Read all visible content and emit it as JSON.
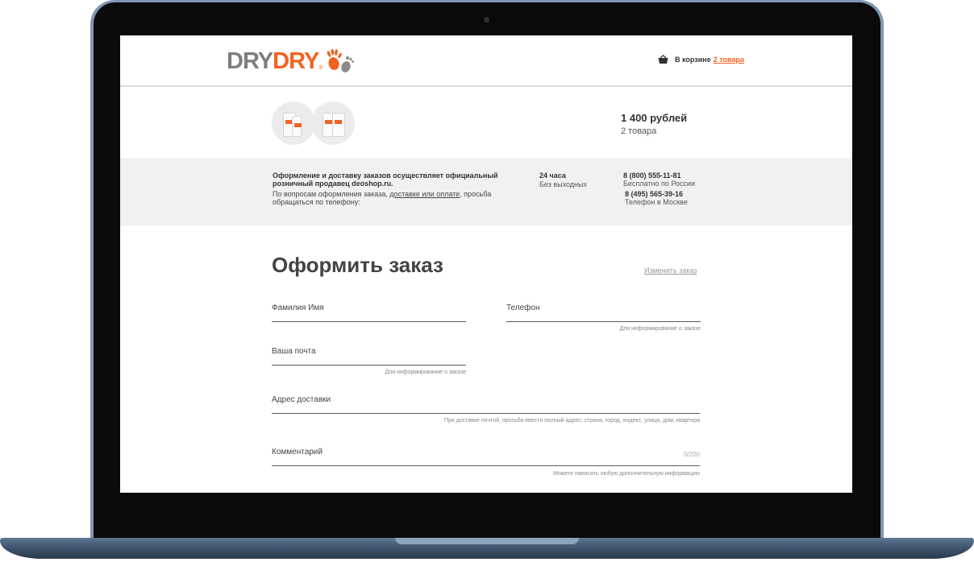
{
  "header": {
    "logo_left": "DRY",
    "logo_right": "DRY",
    "logo_reg": "®",
    "cart_label": "В корзине",
    "cart_link": "2 товара",
    "cart_icon": "basket-icon"
  },
  "order_summary": {
    "price": "1 400 рублей",
    "count": "2 товара"
  },
  "info": {
    "seller_bold": "Оформление и доставку заказов осуществляет официальный розничный продавец deoshop.ru.",
    "contact_before": "По вопросам оформления заказа, ",
    "contact_link": "доставке или оплате",
    "contact_after": ", просьба обращаться по телефону:",
    "hours": "24 часа",
    "days": "Без выходных",
    "phone1": "8 (800) 555-11-81",
    "phone1_note": "Бесплатно по России",
    "phone2": "8 (495) 565-39-16",
    "phone2_note": "Телефон в Москве"
  },
  "form": {
    "title": "Оформить заказ",
    "edit_link": "Изменить заказ",
    "name_label": "Фамилия Имя",
    "phone_label": "Телефон",
    "phone_hint": "Для информирование о заказе",
    "email_label": "Ваша почта",
    "email_hint": "Для информирование о заказе",
    "address_label": "Адрес доставки",
    "address_hint": "При доставке почтой, просьба ввести полный адрес: страна, город, индекс, улица, дом, квартира",
    "comment_label": "Комментарий",
    "comment_counter": "0/200",
    "comment_hint": "Можете написать любую дополнительную информацию"
  },
  "colors": {
    "brand_orange": "#f26322",
    "logo_gray": "#7d7d7d",
    "laptop_frame": "#7e98b3"
  }
}
